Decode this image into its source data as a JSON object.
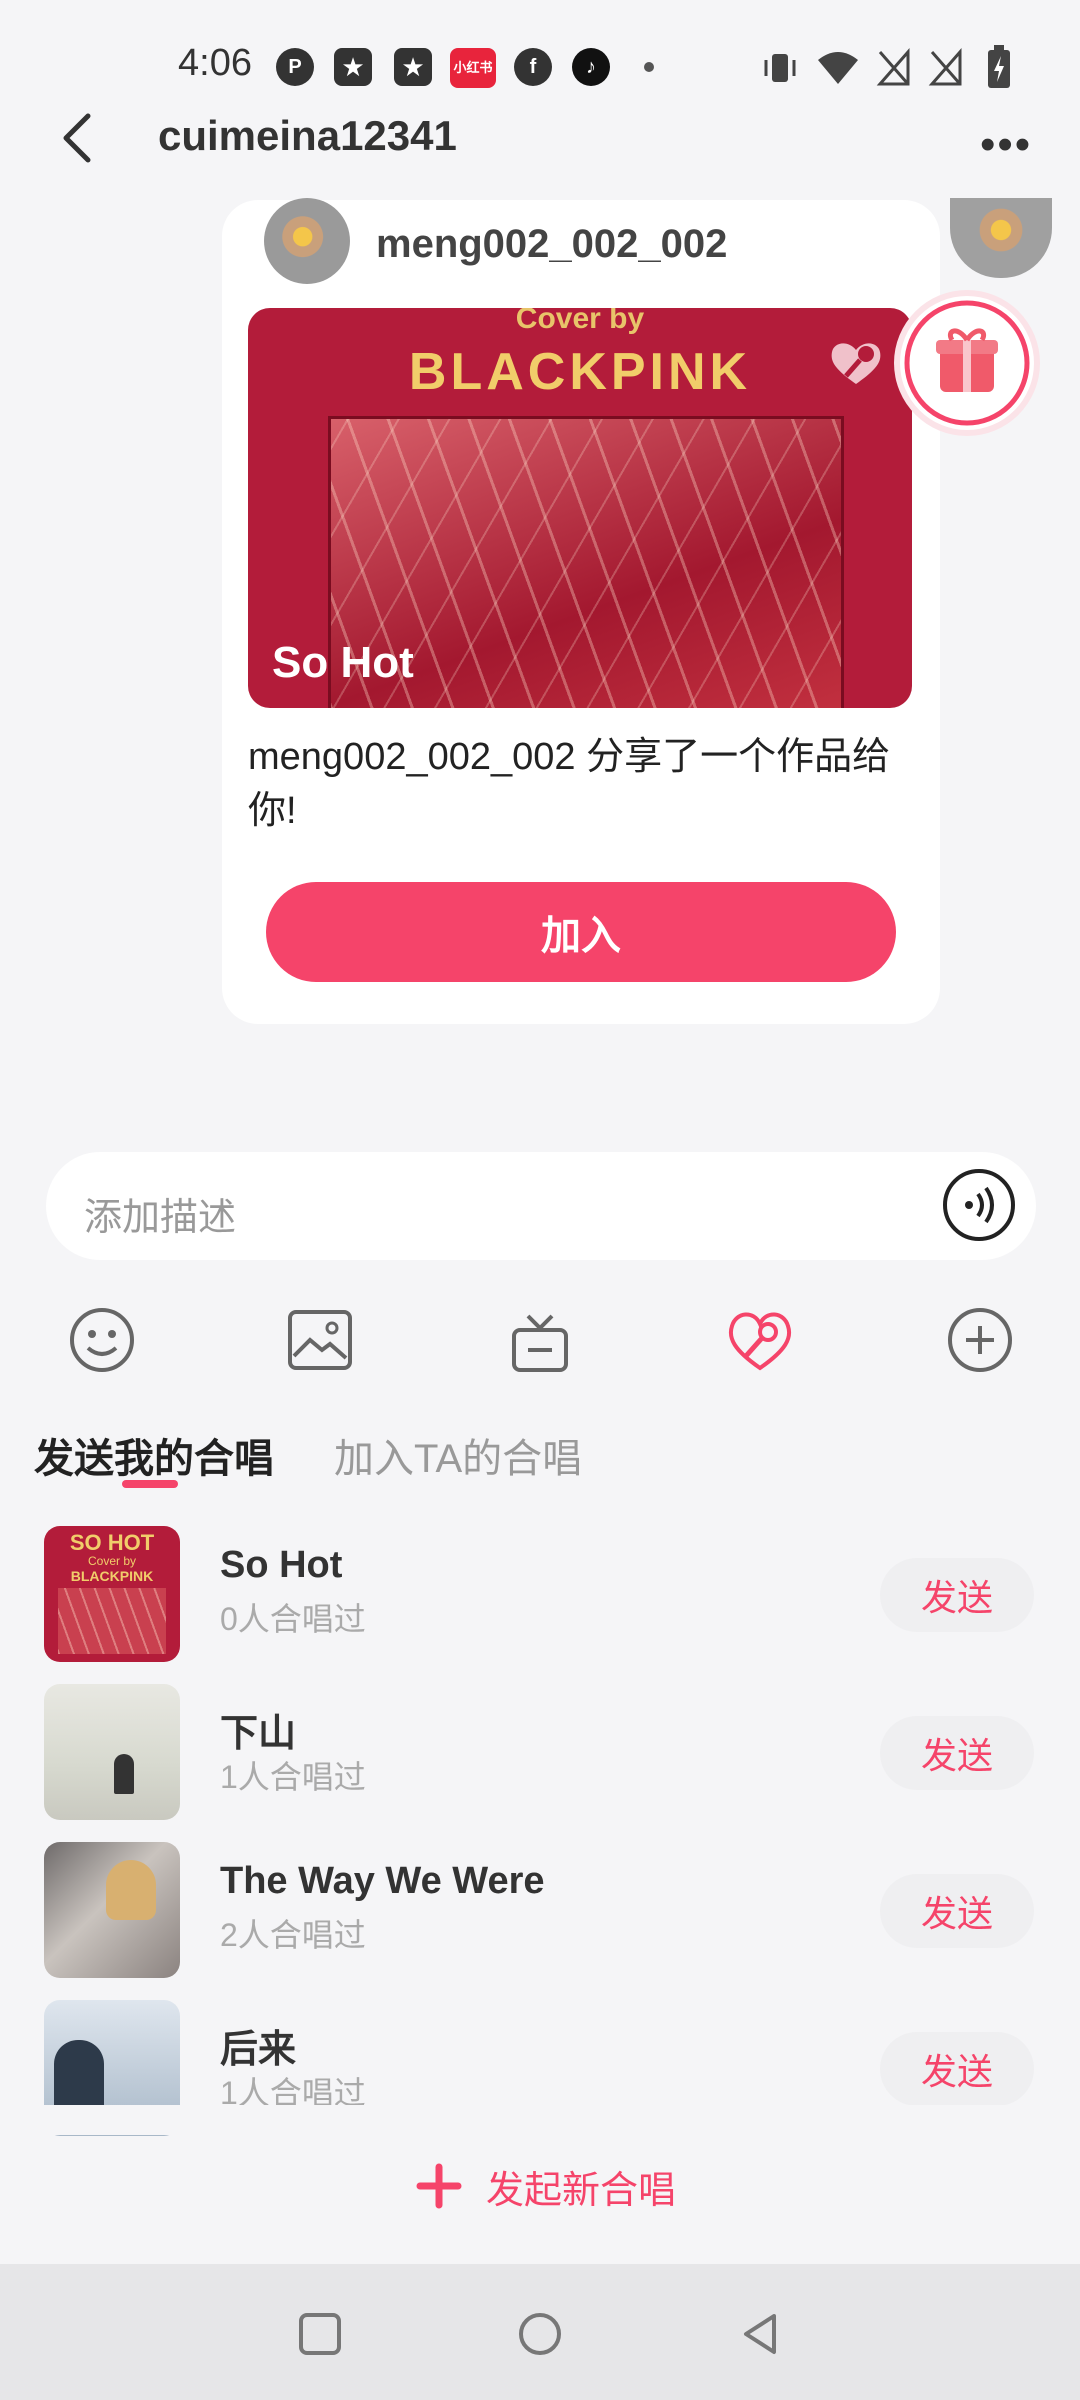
{
  "status_bar": {
    "time": "4:06",
    "app_icons": [
      "p-icon",
      "star-app-icon",
      "star-app-icon",
      "xiaohongshu-icon",
      "facebook-icon",
      "tiktok-icon",
      "dot-icon"
    ],
    "system_icons": [
      "vibrate-icon",
      "wifi-icon",
      "no-signal-icon",
      "no-signal-icon",
      "battery-charging-icon"
    ],
    "xiaohongshu_label": "小红书"
  },
  "header": {
    "title": "cuimeina12341",
    "back_icon": "back-arrow-icon",
    "more_icon": "more-dots-icon",
    "more_label": "•••"
  },
  "card": {
    "sender_name": "meng002_002_002",
    "cover_top": "Cover by",
    "cover_brand": "BLACKPINK",
    "song": "So Hot",
    "share_text": "meng002_002_002 分享了一个作品给你!",
    "join_label": "加入"
  },
  "input": {
    "placeholder": "添加描述"
  },
  "toolbar": [
    "emoji-icon",
    "image-icon",
    "gift-icon",
    "chorus-icon",
    "add-icon"
  ],
  "tabs": [
    "发送我的合唱",
    "加入TA的合唱"
  ],
  "songs": [
    {
      "title": "So Hot",
      "sub": "0人合唱过",
      "send": "发送"
    },
    {
      "title": "下山",
      "sub": "1人合唱过",
      "send": "发送"
    },
    {
      "title": "The Way We Were",
      "sub": "2人合唱过",
      "send": "发送"
    },
    {
      "title": "后来",
      "sub": "1人合唱过",
      "send": "发送"
    }
  ],
  "thumb_labels": {
    "so_hot_1": "SO HOT",
    "so_hot_2": "Cover by",
    "so_hot_3": "BLACKPINK"
  },
  "new_chorus": "发起新合唱",
  "colors": {
    "accent": "#f5446a",
    "background": "#f5f5f7"
  }
}
